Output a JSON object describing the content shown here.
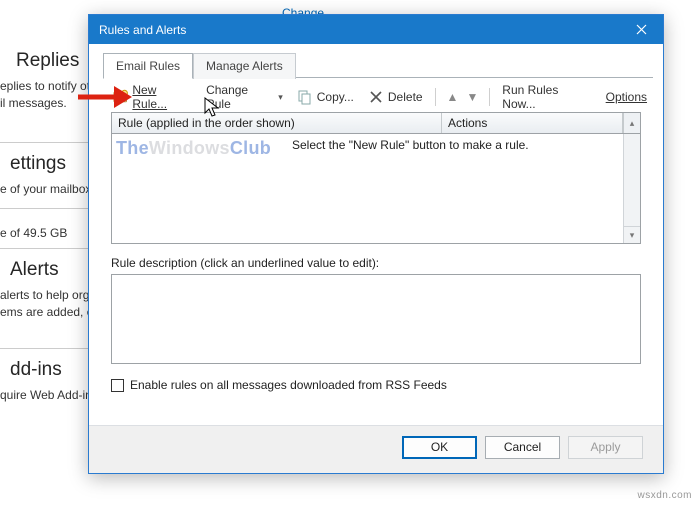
{
  "background": {
    "change_link": "Change",
    "replies_title": "Replies",
    "replies_l1": "eplies to notify ot",
    "replies_l2": "il messages.",
    "settings_title": "ettings",
    "settings_l1": "e of your mailbox",
    "storage_l1": "e of 49.5 GB",
    "alerts_title": "Alerts",
    "alerts_l1": "alerts to help orga",
    "alerts_l2": "ems are added, c",
    "addins_title": "dd-ins",
    "addins_l1": "quire Web Add-in"
  },
  "dialog": {
    "title": "Rules and Alerts",
    "tabs": {
      "email": "Email Rules",
      "manage": "Manage Alerts"
    },
    "toolbar": {
      "new_rule": "New Rule...",
      "change_rule": "Change Rule",
      "copy": "Copy...",
      "delete": "Delete",
      "run_now": "Run Rules Now...",
      "options": "Options"
    },
    "rules_header": {
      "col1": "Rule (applied in the order shown)",
      "col2": "Actions"
    },
    "empty_msg": "Select the \"New Rule\" button to make a rule.",
    "desc_label": "Rule description (click an underlined value to edit):",
    "rss_checkbox": "Enable rules on all messages downloaded from RSS Feeds",
    "buttons": {
      "ok": "OK",
      "cancel": "Cancel",
      "apply": "Apply"
    }
  },
  "watermark": {
    "the": "The",
    "windows": "Windows",
    "club": "Club"
  },
  "footer_mark": "wsxdn.com"
}
